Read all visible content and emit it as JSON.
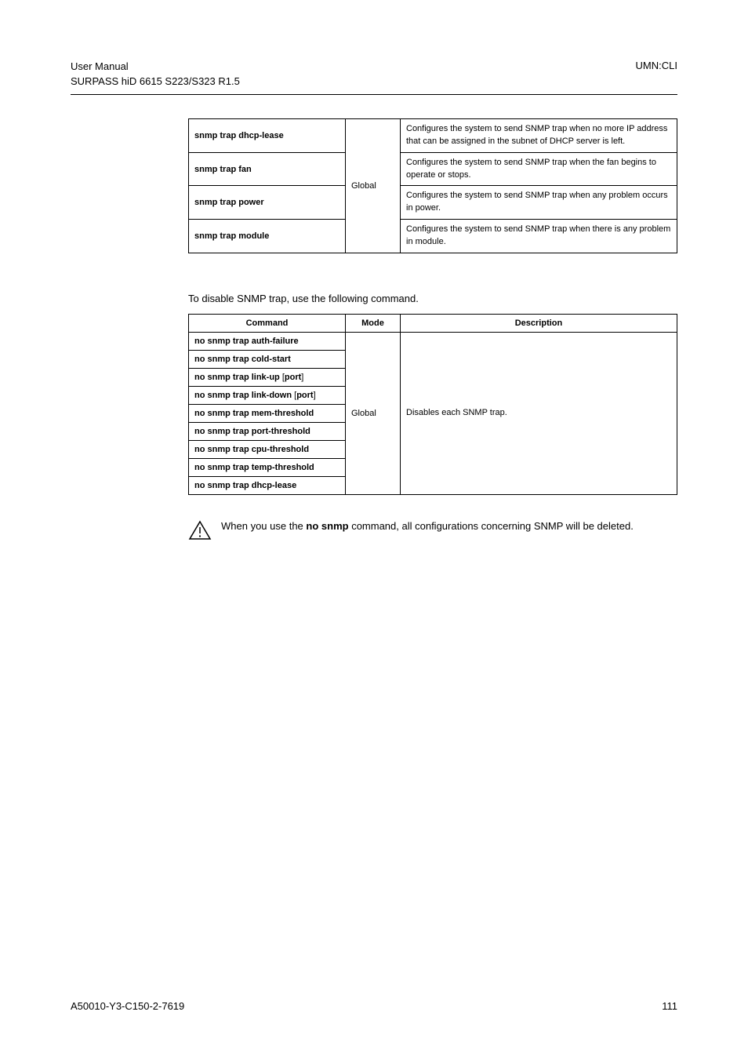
{
  "header": {
    "left_line1": "User Manual",
    "left_line2": "SURPASS hiD 6615 S223/S323 R1.5",
    "right": "UMN:CLI"
  },
  "table1": {
    "rows": [
      {
        "cmd": "snmp trap dhcp-lease",
        "desc": "Configures the system to send SNMP trap when no more IP address that can be assigned in the subnet of DHCP server is left."
      },
      {
        "cmd": "snmp trap fan",
        "desc": "Configures the system to send SNMP trap when the fan begins to operate or stops."
      },
      {
        "cmd": "snmp trap power",
        "desc": "Configures the system to send SNMP trap when any problem occurs in power."
      },
      {
        "cmd": "snmp trap module",
        "desc": "Configures the system to send SNMP trap when there is any problem in module."
      }
    ],
    "mode": "Global"
  },
  "intro": "To disable SNMP trap, use the following command.",
  "table2": {
    "headers": {
      "cmd": "Command",
      "mode": "Mode",
      "desc": "Description"
    },
    "rows": [
      {
        "cmd_parts": [
          {
            "t": "no snmp trap auth-failure",
            "b": true
          }
        ]
      },
      {
        "cmd_parts": [
          {
            "t": "no snmp trap cold-start",
            "b": true
          }
        ]
      },
      {
        "cmd_parts": [
          {
            "t": "no snmp trap link-up",
            "b": true
          },
          {
            "t": " [",
            "b": false
          },
          {
            "t": "port",
            "b": true
          },
          {
            "t": "]",
            "b": false
          }
        ]
      },
      {
        "cmd_parts": [
          {
            "t": "no snmp trap link-down",
            "b": true
          },
          {
            "t": " [",
            "b": false
          },
          {
            "t": "port",
            "b": true
          },
          {
            "t": "]",
            "b": false
          }
        ]
      },
      {
        "cmd_parts": [
          {
            "t": "no snmp trap mem-threshold",
            "b": true
          }
        ]
      },
      {
        "cmd_parts": [
          {
            "t": "no snmp trap port-threshold",
            "b": true
          }
        ]
      },
      {
        "cmd_parts": [
          {
            "t": "no snmp trap cpu-threshold",
            "b": true
          }
        ]
      },
      {
        "cmd_parts": [
          {
            "t": "no snmp trap temp-threshold",
            "b": true
          }
        ]
      },
      {
        "cmd_parts": [
          {
            "t": "no snmp trap dhcp-lease",
            "b": true
          }
        ]
      }
    ],
    "mode": "Global",
    "desc": "Disables each SNMP trap."
  },
  "info": {
    "prefix": "When you use the ",
    "cmd": "no snmp",
    "suffix": " command, all configurations concerning SNMP will be deleted."
  },
  "footer": {
    "left": "A50010-Y3-C150-2-7619",
    "right": "111"
  }
}
